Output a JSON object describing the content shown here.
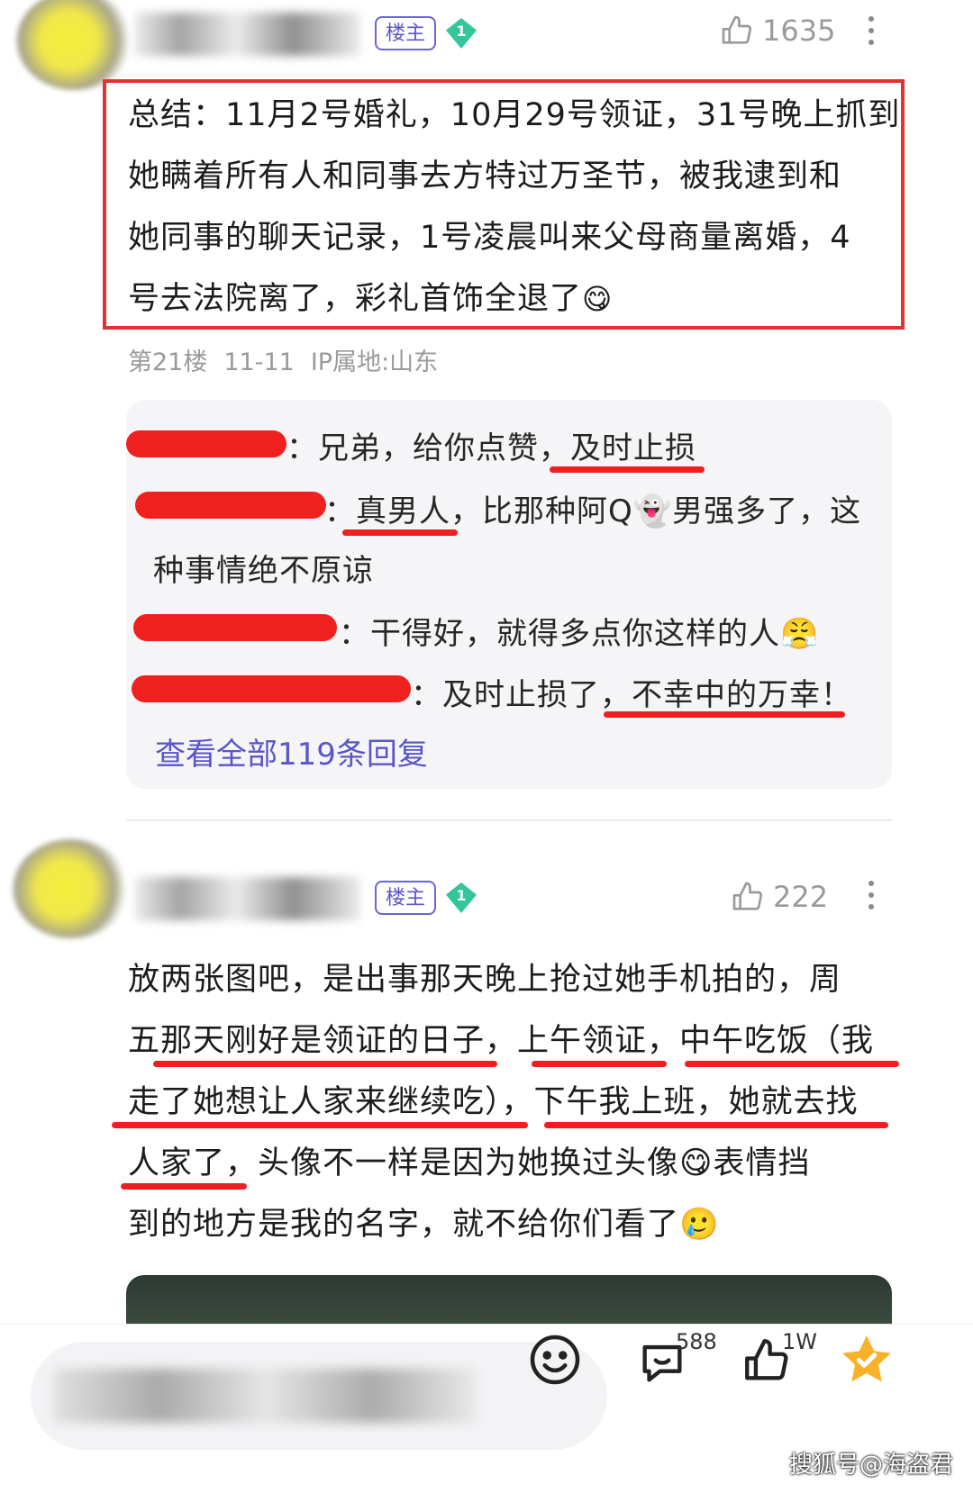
{
  "post1": {
    "host_badge": "楼主",
    "level": "1",
    "likes": "1635",
    "lines": [
      "总结：11月2号婚礼，10月29号领证，31号晚上抓到",
      "她瞒着所有人和同事去方特过万圣节，被我逮到和",
      "她同事的聊天记录，1号凌晨叫来父母商量离婚，4",
      "号去法院离了，彩礼首饰全退了"
    ],
    "line4_emoji": "😋",
    "meta": {
      "floor": "第21楼",
      "date": "11-11",
      "ip": "IP属地:山东"
    },
    "replies": [
      {
        "text": "：兄弟，给你点赞，及时止损"
      },
      {
        "text": "：真男人，比那种阿Q👻男强多了，这"
      },
      {
        "text": "种事情绝不原谅"
      },
      {
        "text": "：干得好，就得多点你这样的人😤"
      },
      {
        "text": "：及时止损了，不幸中的万幸！"
      }
    ],
    "view_all": "查看全部119条回复"
  },
  "post2": {
    "host_badge": "楼主",
    "level": "1",
    "likes": "222",
    "lines": [
      "放两张图吧，是出事那天晚上抢过她手机拍的，周",
      "五那天刚好是领证的日子，上午领证，中午吃饭（我",
      "走了她想让人家来继续吃），下午我上班，她就去找",
      "人家了，头像不一样是因为她换过头像😋表情挡",
      "到的地方是我的名字，就不给你们看了🥲"
    ]
  },
  "bottom_bar": {
    "comments_count": "588",
    "likes_count": "1W",
    "icons": [
      "emoji-icon",
      "comment-icon",
      "thumbs-up-icon",
      "star-icon"
    ]
  },
  "watermark": "搜狐号@海盗君",
  "colors": {
    "accent": "#5a55c8",
    "red": "#e53131",
    "gem": "#34c59a"
  }
}
